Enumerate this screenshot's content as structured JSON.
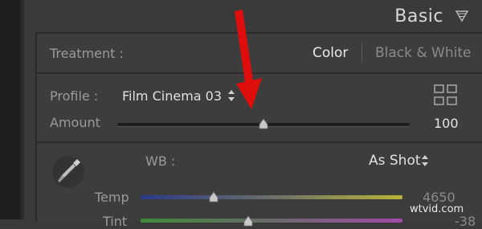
{
  "panel": {
    "title": "Basic",
    "collapse_icon": "triangle-down-icon"
  },
  "treatment": {
    "label": "Treatment :",
    "options": [
      "Color",
      "Black & White"
    ],
    "selected": "Color"
  },
  "profile": {
    "label": "Profile :",
    "value": "Film Cinema 03",
    "stepper_icon": "updown-arrows-icon",
    "browser_icon": "grid-icon"
  },
  "amount": {
    "label": "Amount",
    "value": "100",
    "slider_fraction": 0.5
  },
  "white_balance": {
    "label": "WB :",
    "value": "As Shot",
    "tool_icon": "eyedropper-icon"
  },
  "temp": {
    "label": "Temp",
    "value": "4650",
    "slider_fraction": 0.28
  },
  "tint": {
    "label": "Tint",
    "value": "-38",
    "slider_fraction": 0.41
  },
  "annotation": {
    "arrow_color": "#e00d0d"
  },
  "watermark": "wtvid.com",
  "colors": {
    "panel_bg": "#3d3d3d",
    "text_active": "#e9e9e9",
    "text_muted": "#9a9a9a"
  }
}
